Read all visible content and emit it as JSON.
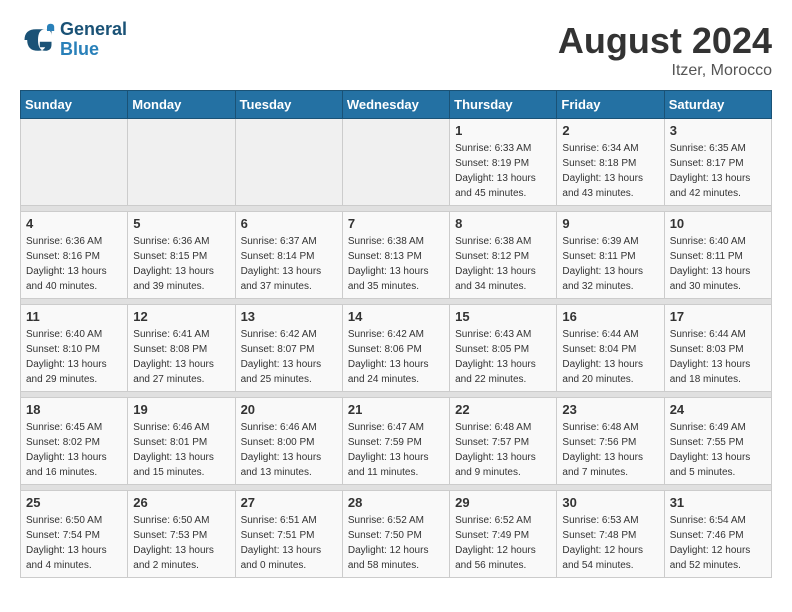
{
  "logo": {
    "line1": "General",
    "line2": "Blue"
  },
  "title": "August 2024",
  "location": "Itzer, Morocco",
  "headers": [
    "Sunday",
    "Monday",
    "Tuesday",
    "Wednesday",
    "Thursday",
    "Friday",
    "Saturday"
  ],
  "weeks": [
    [
      {
        "day": "",
        "info": ""
      },
      {
        "day": "",
        "info": ""
      },
      {
        "day": "",
        "info": ""
      },
      {
        "day": "",
        "info": ""
      },
      {
        "day": "1",
        "info": "Sunrise: 6:33 AM\nSunset: 8:19 PM\nDaylight: 13 hours\nand 45 minutes."
      },
      {
        "day": "2",
        "info": "Sunrise: 6:34 AM\nSunset: 8:18 PM\nDaylight: 13 hours\nand 43 minutes."
      },
      {
        "day": "3",
        "info": "Sunrise: 6:35 AM\nSunset: 8:17 PM\nDaylight: 13 hours\nand 42 minutes."
      }
    ],
    [
      {
        "day": "4",
        "info": "Sunrise: 6:36 AM\nSunset: 8:16 PM\nDaylight: 13 hours\nand 40 minutes."
      },
      {
        "day": "5",
        "info": "Sunrise: 6:36 AM\nSunset: 8:15 PM\nDaylight: 13 hours\nand 39 minutes."
      },
      {
        "day": "6",
        "info": "Sunrise: 6:37 AM\nSunset: 8:14 PM\nDaylight: 13 hours\nand 37 minutes."
      },
      {
        "day": "7",
        "info": "Sunrise: 6:38 AM\nSunset: 8:13 PM\nDaylight: 13 hours\nand 35 minutes."
      },
      {
        "day": "8",
        "info": "Sunrise: 6:38 AM\nSunset: 8:12 PM\nDaylight: 13 hours\nand 34 minutes."
      },
      {
        "day": "9",
        "info": "Sunrise: 6:39 AM\nSunset: 8:11 PM\nDaylight: 13 hours\nand 32 minutes."
      },
      {
        "day": "10",
        "info": "Sunrise: 6:40 AM\nSunset: 8:11 PM\nDaylight: 13 hours\nand 30 minutes."
      }
    ],
    [
      {
        "day": "11",
        "info": "Sunrise: 6:40 AM\nSunset: 8:10 PM\nDaylight: 13 hours\nand 29 minutes."
      },
      {
        "day": "12",
        "info": "Sunrise: 6:41 AM\nSunset: 8:08 PM\nDaylight: 13 hours\nand 27 minutes."
      },
      {
        "day": "13",
        "info": "Sunrise: 6:42 AM\nSunset: 8:07 PM\nDaylight: 13 hours\nand 25 minutes."
      },
      {
        "day": "14",
        "info": "Sunrise: 6:42 AM\nSunset: 8:06 PM\nDaylight: 13 hours\nand 24 minutes."
      },
      {
        "day": "15",
        "info": "Sunrise: 6:43 AM\nSunset: 8:05 PM\nDaylight: 13 hours\nand 22 minutes."
      },
      {
        "day": "16",
        "info": "Sunrise: 6:44 AM\nSunset: 8:04 PM\nDaylight: 13 hours\nand 20 minutes."
      },
      {
        "day": "17",
        "info": "Sunrise: 6:44 AM\nSunset: 8:03 PM\nDaylight: 13 hours\nand 18 minutes."
      }
    ],
    [
      {
        "day": "18",
        "info": "Sunrise: 6:45 AM\nSunset: 8:02 PM\nDaylight: 13 hours\nand 16 minutes."
      },
      {
        "day": "19",
        "info": "Sunrise: 6:46 AM\nSunset: 8:01 PM\nDaylight: 13 hours\nand 15 minutes."
      },
      {
        "day": "20",
        "info": "Sunrise: 6:46 AM\nSunset: 8:00 PM\nDaylight: 13 hours\nand 13 minutes."
      },
      {
        "day": "21",
        "info": "Sunrise: 6:47 AM\nSunset: 7:59 PM\nDaylight: 13 hours\nand 11 minutes."
      },
      {
        "day": "22",
        "info": "Sunrise: 6:48 AM\nSunset: 7:57 PM\nDaylight: 13 hours\nand 9 minutes."
      },
      {
        "day": "23",
        "info": "Sunrise: 6:48 AM\nSunset: 7:56 PM\nDaylight: 13 hours\nand 7 minutes."
      },
      {
        "day": "24",
        "info": "Sunrise: 6:49 AM\nSunset: 7:55 PM\nDaylight: 13 hours\nand 5 minutes."
      }
    ],
    [
      {
        "day": "25",
        "info": "Sunrise: 6:50 AM\nSunset: 7:54 PM\nDaylight: 13 hours\nand 4 minutes."
      },
      {
        "day": "26",
        "info": "Sunrise: 6:50 AM\nSunset: 7:53 PM\nDaylight: 13 hours\nand 2 minutes."
      },
      {
        "day": "27",
        "info": "Sunrise: 6:51 AM\nSunset: 7:51 PM\nDaylight: 13 hours\nand 0 minutes."
      },
      {
        "day": "28",
        "info": "Sunrise: 6:52 AM\nSunset: 7:50 PM\nDaylight: 12 hours\nand 58 minutes."
      },
      {
        "day": "29",
        "info": "Sunrise: 6:52 AM\nSunset: 7:49 PM\nDaylight: 12 hours\nand 56 minutes."
      },
      {
        "day": "30",
        "info": "Sunrise: 6:53 AM\nSunset: 7:48 PM\nDaylight: 12 hours\nand 54 minutes."
      },
      {
        "day": "31",
        "info": "Sunrise: 6:54 AM\nSunset: 7:46 PM\nDaylight: 12 hours\nand 52 minutes."
      }
    ]
  ]
}
